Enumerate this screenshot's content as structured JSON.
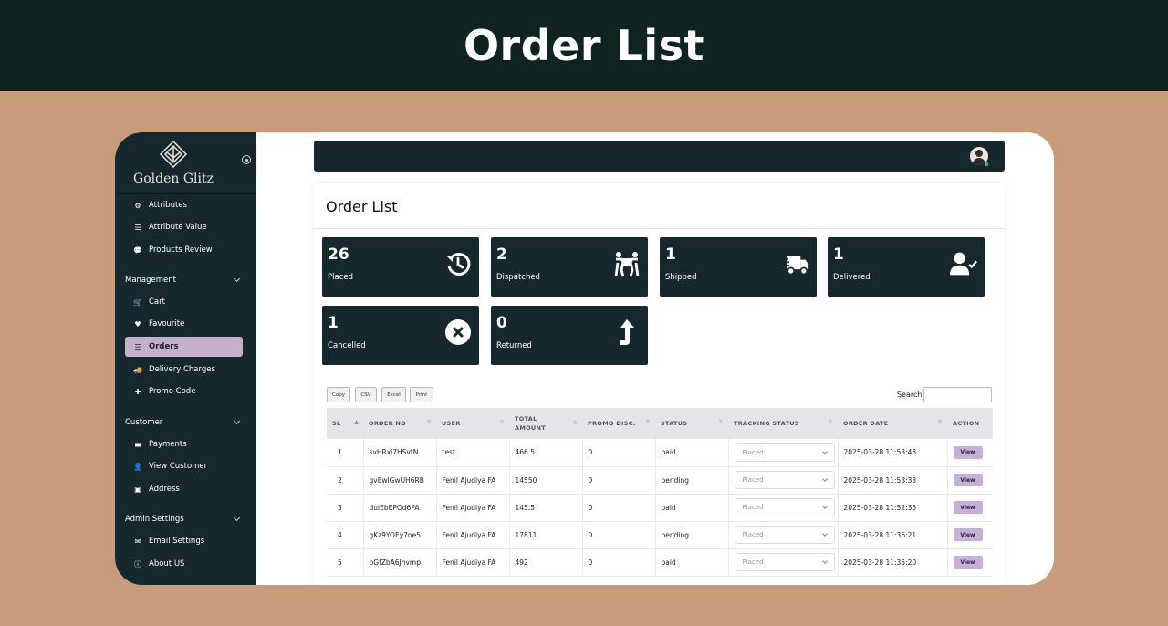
{
  "banner": {
    "title": "Order List"
  },
  "sidebar": {
    "brand": "Golden Glitz",
    "items_top": [
      {
        "label": "Attributes",
        "icon": "cogs-icon"
      },
      {
        "label": "Attribute Value",
        "icon": "list-icon"
      },
      {
        "label": "Products Review",
        "icon": "comments-icon"
      }
    ],
    "sections": [
      {
        "title": "Management",
        "items": [
          {
            "label": "Cart",
            "icon": "cart-icon"
          },
          {
            "label": "Favourite",
            "icon": "heart-icon"
          },
          {
            "label": "Orders",
            "icon": "list-icon",
            "active": true
          },
          {
            "label": "Delivery Charges",
            "icon": "truck-icon"
          },
          {
            "label": "Promo Code",
            "icon": "puzzle-icon"
          }
        ]
      },
      {
        "title": "Customer",
        "items": [
          {
            "label": "Payments",
            "icon": "credit-card-icon"
          },
          {
            "label": "View Customer",
            "icon": "user-icon"
          },
          {
            "label": "Address",
            "icon": "address-book-icon"
          }
        ]
      },
      {
        "title": "Admin Settings",
        "items": [
          {
            "label": "Email Settings",
            "icon": "envelope-icon"
          },
          {
            "label": "About US",
            "icon": "info-icon"
          }
        ]
      }
    ],
    "active_color": "#c6afc8",
    "bg_color": "#15282e"
  },
  "page": {
    "title": "Order List"
  },
  "stats": [
    {
      "value": "26",
      "label": "Placed",
      "icon": "history-icon"
    },
    {
      "value": "2",
      "label": "Dispatched",
      "icon": "people-carry-icon"
    },
    {
      "value": "1",
      "label": "Shipped",
      "icon": "shipping-fast-icon"
    },
    {
      "value": "1",
      "label": "Delivered",
      "icon": "user-check-icon"
    },
    {
      "value": "1",
      "label": "Cancelled",
      "icon": "times-circle-icon"
    },
    {
      "value": "0",
      "label": "Returned",
      "icon": "level-up-icon"
    }
  ],
  "toolbar": {
    "copy": "Copy",
    "csv": "CSV",
    "excel": "Excel",
    "print": "Print",
    "search_label": "Search:"
  },
  "table": {
    "headers": [
      "SL",
      "ORDER NO",
      "USER",
      "TOTAL AMOUNT",
      "PROMO DISC.",
      "STATUS",
      "TRACKING STATUS",
      "ORDER DATE",
      "ACTION"
    ],
    "rows": [
      {
        "sl": "1",
        "order_no": "svHRxi7HSvtN",
        "user": "test",
        "total": "466.5",
        "promo": "0",
        "status": "paid",
        "tracking": "Placed",
        "date": "2025-03-28 11:53:48",
        "action": "View"
      },
      {
        "sl": "2",
        "order_no": "gvEwlGwUH6RB",
        "user": "Fenil Ajudiya FA",
        "total": "14550",
        "promo": "0",
        "status": "pending",
        "tracking": "Placed",
        "date": "2025-03-28 11:53:33",
        "action": "View"
      },
      {
        "sl": "3",
        "order_no": "duiEbEPOd6PA",
        "user": "Fenil Ajudiya FA",
        "total": "145.5",
        "promo": "0",
        "status": "paid",
        "tracking": "Placed",
        "date": "2025-03-28 11:52:33",
        "action": "View"
      },
      {
        "sl": "4",
        "order_no": "gKz9YOEy7ne5",
        "user": "Fenil Ajudiya FA",
        "total": "17811",
        "promo": "0",
        "status": "pending",
        "tracking": "Placed",
        "date": "2025-03-28 11:36:21",
        "action": "View"
      },
      {
        "sl": "5",
        "order_no": "bGfZbA6Jhvmp",
        "user": "Fenil Ajudiya FA",
        "total": "492",
        "promo": "0",
        "status": "paid",
        "tracking": "Placed",
        "date": "2025-03-28 11:35:20",
        "action": "View"
      }
    ]
  }
}
